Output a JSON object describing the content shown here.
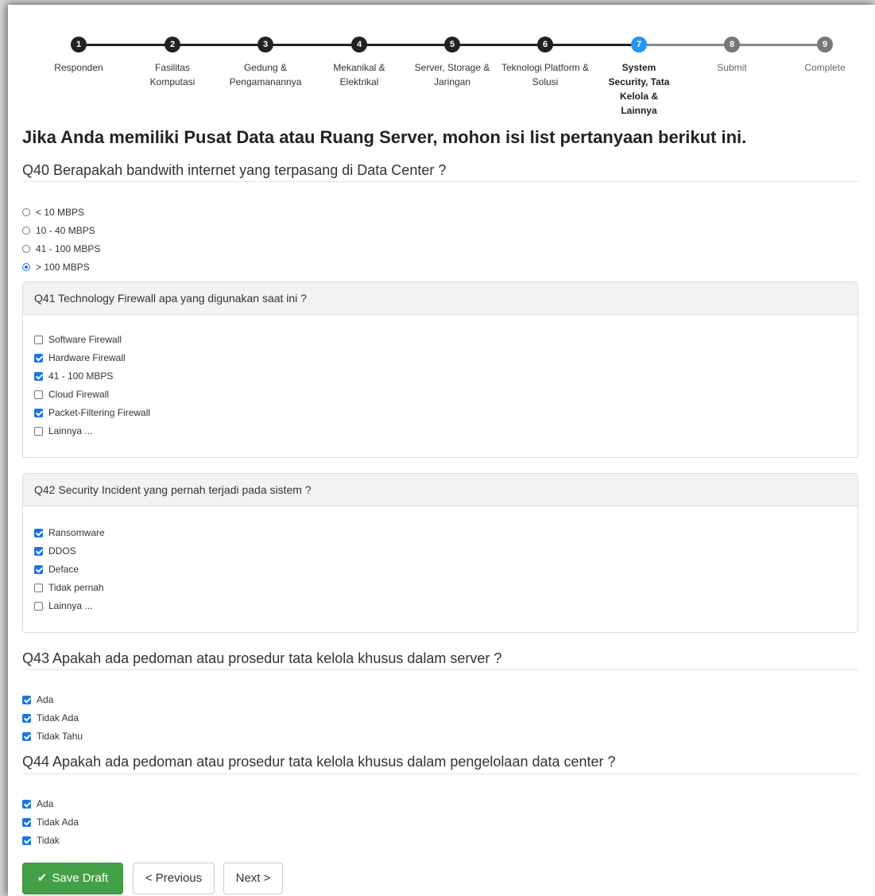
{
  "stepper": {
    "steps": [
      {
        "num": "1",
        "label": "Responden"
      },
      {
        "num": "2",
        "label": "Fasilitas Komputasi"
      },
      {
        "num": "3",
        "label": "Gedung & Pengamanannya"
      },
      {
        "num": "4",
        "label": "Mekanikal & Elektrikal"
      },
      {
        "num": "5",
        "label": "Server, Storage & Jaringan"
      },
      {
        "num": "6",
        "label": "Teknologi Platform & Solusi"
      },
      {
        "num": "7",
        "label": "System Security, Tata Kelola & Lainnya"
      },
      {
        "num": "8",
        "label": "Submit"
      },
      {
        "num": "9",
        "label": "Complete"
      }
    ],
    "active_step": 7
  },
  "page_title": "Jika Anda memiliki Pusat Data atau Ruang Server, mohon isi list pertanyaan berikut ini.",
  "q40": {
    "question": "Q40 Berapakah bandwith internet yang terpasang di Data Center ?",
    "options": [
      {
        "label": "< 10 MBPS",
        "selected": false
      },
      {
        "label": "10 - 40 MBPS",
        "selected": false
      },
      {
        "label": "41 - 100 MBPS",
        "selected": false
      },
      {
        "label": "> 100 MBPS",
        "selected": true
      }
    ]
  },
  "q41": {
    "question": "Q41 Technology Firewall apa yang digunakan saat ini ?",
    "options": [
      {
        "label": "Software Firewall",
        "checked": false
      },
      {
        "label": "Hardware Firewall",
        "checked": true
      },
      {
        "label": "41 - 100 MBPS",
        "checked": true
      },
      {
        "label": "Cloud Firewall",
        "checked": false
      },
      {
        "label": "Packet-Filtering Firewall",
        "checked": true
      },
      {
        "label": "Lainnya ...",
        "checked": false
      }
    ]
  },
  "q42": {
    "question": "Q42 Security Incident yang pernah terjadi pada sistem ?",
    "options": [
      {
        "label": "Ransomware",
        "checked": true
      },
      {
        "label": "DDOS",
        "checked": true
      },
      {
        "label": "Deface",
        "checked": true
      },
      {
        "label": "Tidak pernah",
        "checked": false
      },
      {
        "label": "Lainnya ...",
        "checked": false
      }
    ]
  },
  "q43": {
    "question": "Q43 Apakah ada pedoman atau prosedur tata kelola khusus dalam server ?",
    "options": [
      {
        "label": "Ada",
        "checked": true
      },
      {
        "label": "Tidak Ada",
        "checked": true
      },
      {
        "label": "Tidak Tahu",
        "checked": true
      }
    ]
  },
  "q44": {
    "question": "Q44 Apakah ada pedoman atau prosedur tata kelola khusus dalam pengelolaan data center ?",
    "options": [
      {
        "label": "Ada",
        "checked": true
      },
      {
        "label": "Tidak Ada",
        "checked": true
      },
      {
        "label": "Tidak",
        "checked": true
      }
    ]
  },
  "buttons": {
    "save": "Save Draft",
    "previous": "< Previous",
    "next": "Next >"
  },
  "colors": {
    "active_step": "#2196f3",
    "checked": "#1a73e8",
    "save_button": "#43a047"
  }
}
